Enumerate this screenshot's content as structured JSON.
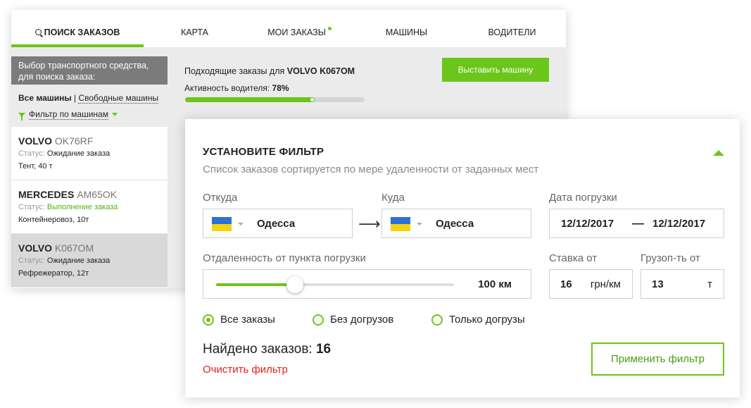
{
  "tabs": [
    {
      "label": "ПОИСК ЗАКАЗОВ",
      "active": true
    },
    {
      "label": "КАРТА"
    },
    {
      "label": "МОИ ЗАКАЗЫ",
      "has_dot": true
    },
    {
      "label": "МАШИНЫ"
    },
    {
      "label": "ВОДИТЕЛИ"
    }
  ],
  "sidebar": {
    "heading": "Выбор транспортного средства, для поиска заказа:",
    "all_label": "Все машины",
    "separator": "|",
    "free_label": "Свободные машины",
    "filter_label": "Фильтр по машинам",
    "vehicles": [
      {
        "brand": "VOLVO",
        "plate": "OK76RF",
        "status_prefix": "Статус:",
        "status": "Ожидание заказа",
        "desc": "Тент, 40 т"
      },
      {
        "brand": "MERCEDES",
        "plate": "AM65OK",
        "status_prefix": "Статус:",
        "status": "Выполнение заказа",
        "desc": "Контейнеровоз, 10т"
      },
      {
        "brand": "VOLVO",
        "plate": "K067OM",
        "status_prefix": "Статус:",
        "status": "Ожидание заказа",
        "desc": "Рефрежератор, 12т"
      }
    ]
  },
  "orders": {
    "heading_prefix": "Подходящие заказы для",
    "heading_vehicle": "VOLVO K067OM",
    "activity_label": "Активность водителя:",
    "activity_value": "78%",
    "activity_fraction": 0.72,
    "post_button": "Выставить машину"
  },
  "filter": {
    "title": "УСТАНОВИТЕ ФИЛЬТР",
    "subtitle": "Список заказов сортируется по мере удаленности от заданных мест",
    "from_label": "Откуда",
    "from_city": "Одесса",
    "to_label": "Куда",
    "to_city": "Одесса",
    "arrow": "⟶",
    "date_label": "Дата погрузки",
    "date_from": "12/12/2017",
    "date_dash": "—",
    "date_to": "12/12/2017",
    "distance_label": "Отдаленность от пункта погрузки",
    "distance_value": "100 км",
    "distance_fraction": 0.33,
    "rate_label": "Ставка от",
    "rate_value": "16",
    "rate_unit": "грн/км",
    "capacity_label": "Грузоп-ть от",
    "capacity_value": "13",
    "capacity_unit": "т",
    "radios": [
      {
        "label": "Все заказы",
        "checked": true
      },
      {
        "label": "Без догрузов",
        "checked": false
      },
      {
        "label": "Только догрузы",
        "checked": false
      }
    ],
    "found_label": "Найдено заказов:",
    "found_count": "16",
    "clear_label": "Очистить фильтр",
    "apply_button": "Применить фильтр"
  },
  "colors": {
    "accent": "#6cc51a",
    "danger": "#ee1c1c",
    "flag_blue": "#2d6fd6",
    "flag_yellow": "#f5d40e"
  },
  "icons": [
    "search-icon",
    "filter-icon",
    "chevron-down-icon",
    "chevron-up-icon",
    "arrow-right-icon",
    "flag-ukraine-icon"
  ]
}
